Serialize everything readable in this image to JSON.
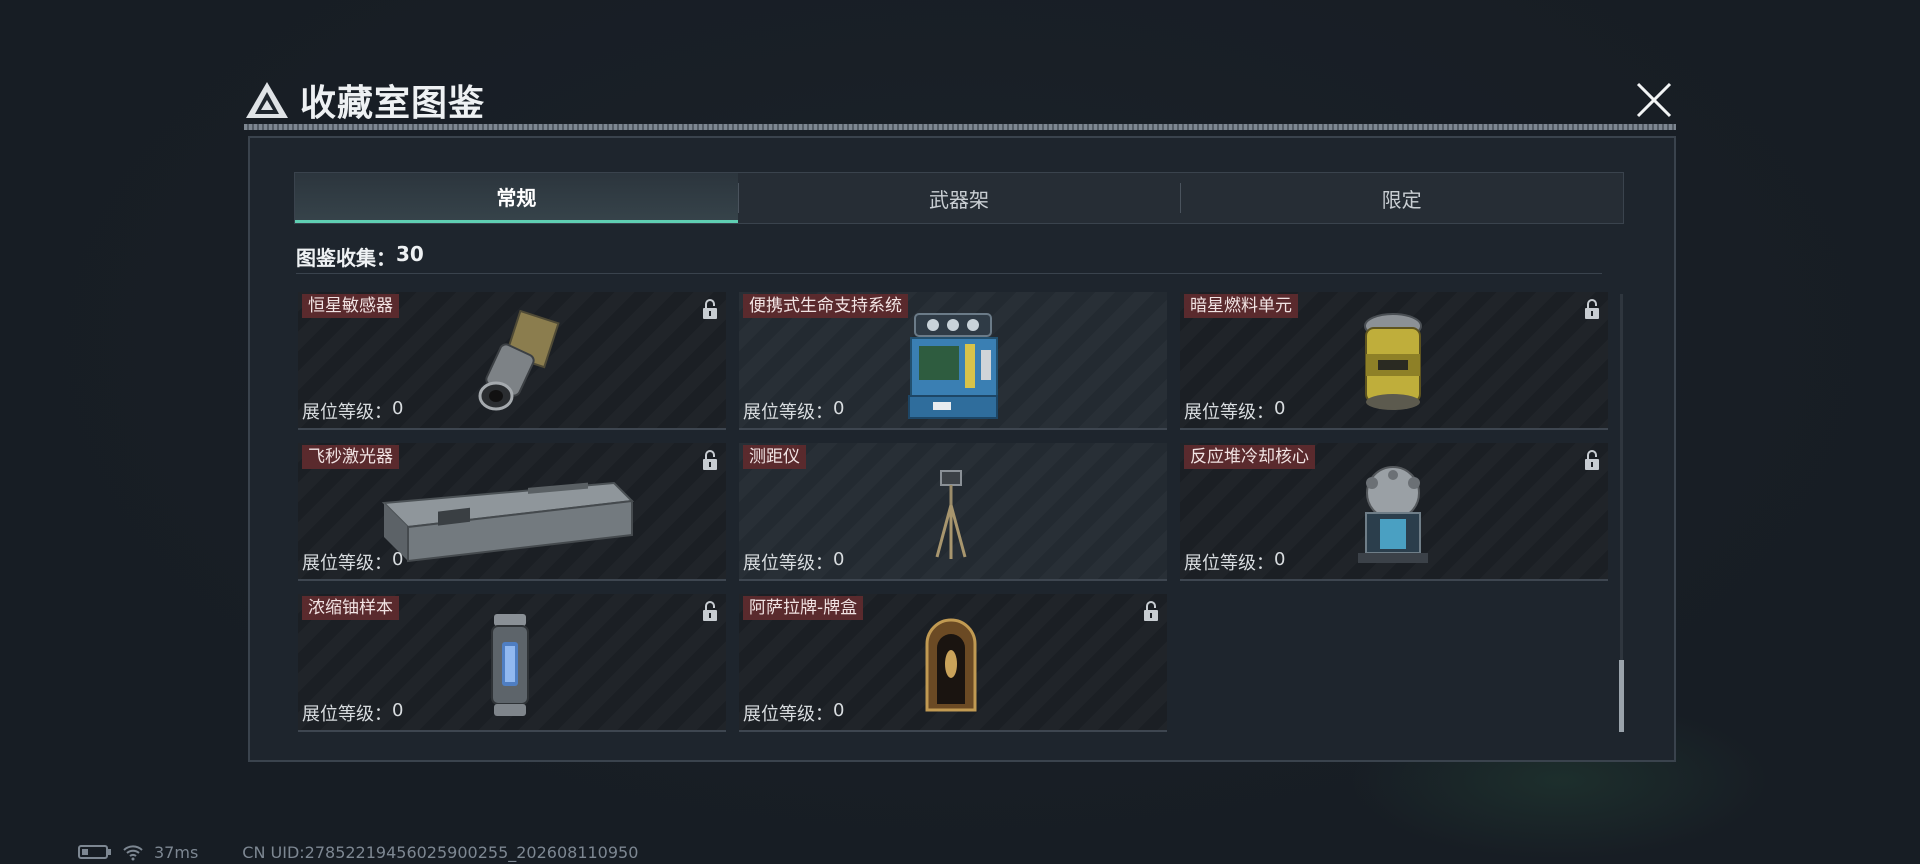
{
  "window": {
    "title": "收藏室图鉴",
    "logo_icon": "triangle-a-logo"
  },
  "tabs": [
    {
      "label": "常规",
      "active": true
    },
    {
      "label": "武器架",
      "active": false
    },
    {
      "label": "限定",
      "active": false
    }
  ],
  "collection": {
    "label": "图鉴收集：",
    "count": "30"
  },
  "items": [
    {
      "name": "恒星敏感器",
      "level_label": "展位等级：",
      "level": "0",
      "locked": true
    },
    {
      "name": "便携式生命支持系统",
      "level_label": "展位等级：",
      "level": "0",
      "locked": false
    },
    {
      "name": "暗星燃料单元",
      "level_label": "展位等级：",
      "level": "0",
      "locked": true
    },
    {
      "name": "飞秒激光器",
      "level_label": "展位等级：",
      "level": "0",
      "locked": true
    },
    {
      "name": "测距仪",
      "level_label": "展位等级：",
      "level": "0",
      "locked": false
    },
    {
      "name": "反应堆冷却核心",
      "level_label": "展位等级：",
      "level": "0",
      "locked": true
    },
    {
      "name": "浓缩铀样本",
      "level_label": "展位等级：",
      "level": "0",
      "locked": true
    },
    {
      "name": "阿萨拉牌-牌盒",
      "level_label": "展位等级：",
      "level": "0",
      "locked": true
    }
  ],
  "status_bar": {
    "ping": "37ms",
    "uid": "CN UID:278522194560259002​55_202608110950"
  },
  "colors": {
    "accent": "#5fcfb3",
    "name_tag_bg": "#5a2a2d",
    "panel_bg": "#1e252d"
  }
}
